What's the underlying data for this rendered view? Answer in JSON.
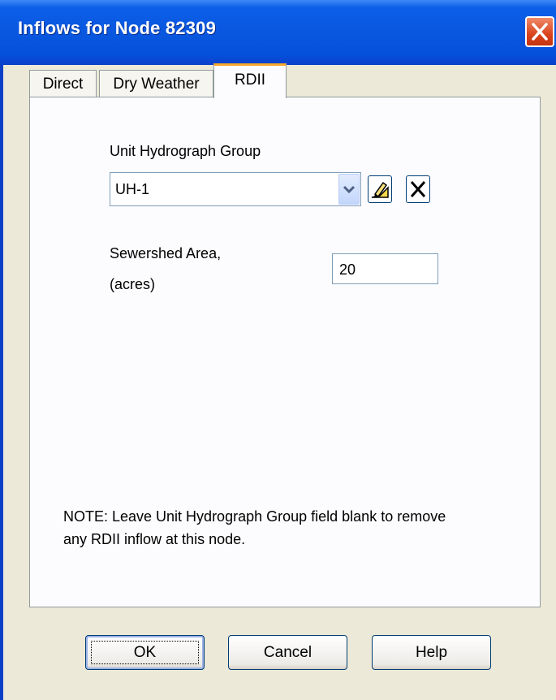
{
  "window": {
    "title": "Inflows for Node 82309"
  },
  "tabs": [
    {
      "label": "Direct",
      "active": false
    },
    {
      "label": "Dry Weather",
      "active": false
    },
    {
      "label": "RDII",
      "active": true
    }
  ],
  "rdii": {
    "uh_group_label": "Unit Hydrograph Group",
    "uh_group_value": "UH-1",
    "area_label_line1": "Sewershed Area,",
    "area_label_line2": "(acres)",
    "area_value": "20",
    "note_line1": "NOTE: Leave Unit Hydrograph Group field blank to remove",
    "note_line2": "any RDII inflow at this node."
  },
  "buttons": {
    "ok": "OK",
    "cancel": "Cancel",
    "help": "Help"
  },
  "icons": {
    "close": "close-icon",
    "dropdown": "chevron-down-icon",
    "edit": "edit-pencil-icon",
    "delete": "x-delete-icon"
  },
  "colors": {
    "titlebar": "#0a58e0",
    "close": "#d9431c",
    "active_tab_accent": "#f5a82e"
  }
}
